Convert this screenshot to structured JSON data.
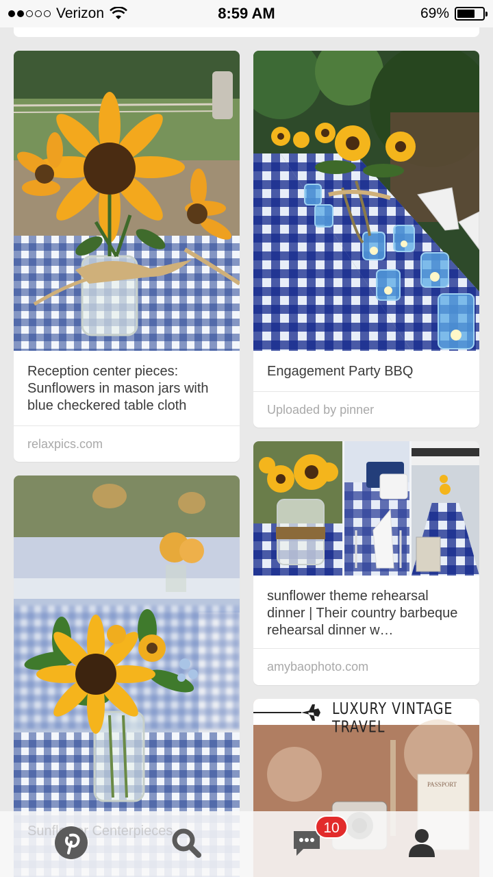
{
  "status_bar": {
    "carrier": "Verizon",
    "time": "8:59 AM",
    "battery_percent_label": "69%",
    "battery_level": 0.69
  },
  "pins": [
    {
      "description": "Reception center pieces: Sunflowers in mason jars with blue checkered table cloth",
      "source": "relaxpics.com"
    },
    {
      "description": "Engagement Party BBQ",
      "source": "Uploaded by pinner"
    },
    {
      "description": "sunflower theme rehearsal dinner | Their country barbeque rehearsal dinner w…",
      "source": "amybaophoto.com"
    },
    {
      "description": "Sunflower Centerpieces",
      "source": ""
    },
    {
      "banner_text": "LUXURY VINTAGE TRAVEL",
      "stamp_text": "PASSPORT"
    }
  ],
  "bottom_nav": {
    "items": [
      {
        "name": "home",
        "icon": "pinterest-logo-icon"
      },
      {
        "name": "search",
        "icon": "search-icon"
      },
      {
        "name": "messages",
        "icon": "chat-bubble-icon"
      },
      {
        "name": "profile",
        "icon": "person-icon"
      }
    ],
    "notification_count": "10"
  },
  "colors": {
    "accent_red": "#e22b2b",
    "background": "#e9e9e9",
    "nav_icon": "#555555"
  }
}
